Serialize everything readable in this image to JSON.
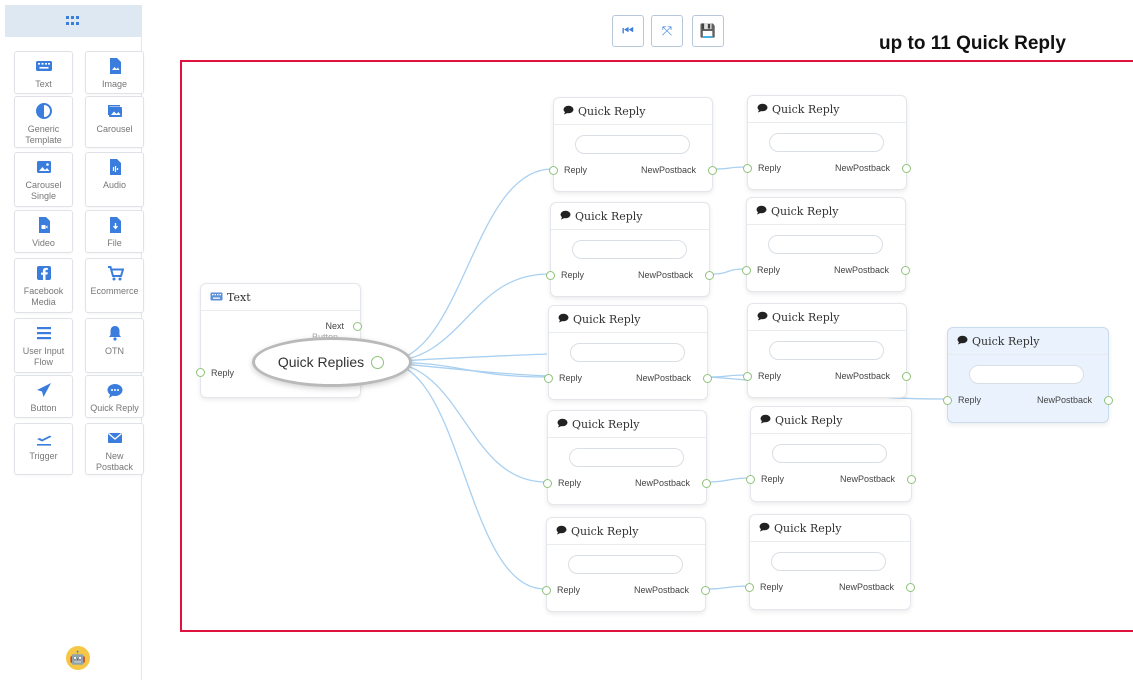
{
  "heading": "up to 11 Quick Reply",
  "colors": {
    "accent": "#3b7ddd",
    "frame": "#e0133f",
    "port": "#8fc27a",
    "wire": "#a9d0f0"
  },
  "toolbar": {
    "buttons": [
      {
        "name": "first-step-button",
        "icon": "skip-back-icon",
        "glyph": "⏮"
      },
      {
        "name": "fit-view-button",
        "icon": "fullscreen-exit-icon",
        "glyph": "⤧"
      },
      {
        "name": "save-button",
        "icon": "save-icon",
        "glyph": "💾"
      }
    ]
  },
  "sidebar": {
    "header_icon": "grid-icon",
    "items": [
      {
        "label": "Text",
        "icon": "keyboard-icon"
      },
      {
        "label": "Image",
        "icon": "image-file-icon"
      },
      {
        "label": "Generic Template",
        "icon": "half-circle-icon"
      },
      {
        "label": "Carousel",
        "icon": "images-icon"
      },
      {
        "label": "Carousel Single",
        "icon": "image-icon"
      },
      {
        "label": "Audio",
        "icon": "audio-file-icon"
      },
      {
        "label": "Video",
        "icon": "video-file-icon"
      },
      {
        "label": "File",
        "icon": "download-file-icon"
      },
      {
        "label": "Facebook Media",
        "icon": "facebook-icon"
      },
      {
        "label": "Ecommerce",
        "icon": "cart-icon"
      },
      {
        "label": "User Input Flow",
        "icon": "list-icon"
      },
      {
        "label": "OTN",
        "icon": "bell-icon"
      },
      {
        "label": "Button",
        "icon": "send-icon"
      },
      {
        "label": "Quick Reply",
        "icon": "chat-icon"
      },
      {
        "label": "Trigger",
        "icon": "plane-icon"
      },
      {
        "label": "New Postback",
        "icon": "envelope-icon"
      }
    ]
  },
  "flow": {
    "text_node": {
      "title": "Text",
      "next_label": "Next",
      "reply_label": "Reply",
      "behind_text": "Button"
    },
    "quick_replies_label": "Quick Replies",
    "quick_reply_title": "Quick Reply",
    "reply_label": "Reply",
    "postback_label": "NewPostback",
    "node_count": 11
  }
}
